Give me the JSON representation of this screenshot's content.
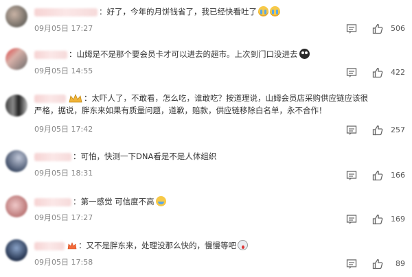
{
  "comments": [
    {
      "text": "：好了，今年的月饼钱省了，我已经快看吐了",
      "time": "09月05日 17:27",
      "likes": "506"
    },
    {
      "text": "：山姆是不是那个要会员卡才可以进去的超市。上次到门口没进去",
      "time": "09月05日 14:55",
      "likes": "422"
    },
    {
      "text": "：太吓人了，不敢看，怎么吃，谁敢吃？按道理说，山姆会员店采购供应链应该很严格，据说，胖东来如果有质量问题，道歉，赔款，供应链移除白名单，永不合作！",
      "time": "09月05日 17:42",
      "likes": "257"
    },
    {
      "text": "：可怕，快测一下DNA看是不是人体组织",
      "time": "09月05日 18:31",
      "likes": "166"
    },
    {
      "text": "：第一感觉 可信度不高",
      "time": "09月05日 17:27",
      "likes": "169"
    },
    {
      "text": "：又不是胖东来，处理没那么快的，慢慢等吧",
      "time": "09月05日 17:58",
      "likes": "89"
    }
  ]
}
